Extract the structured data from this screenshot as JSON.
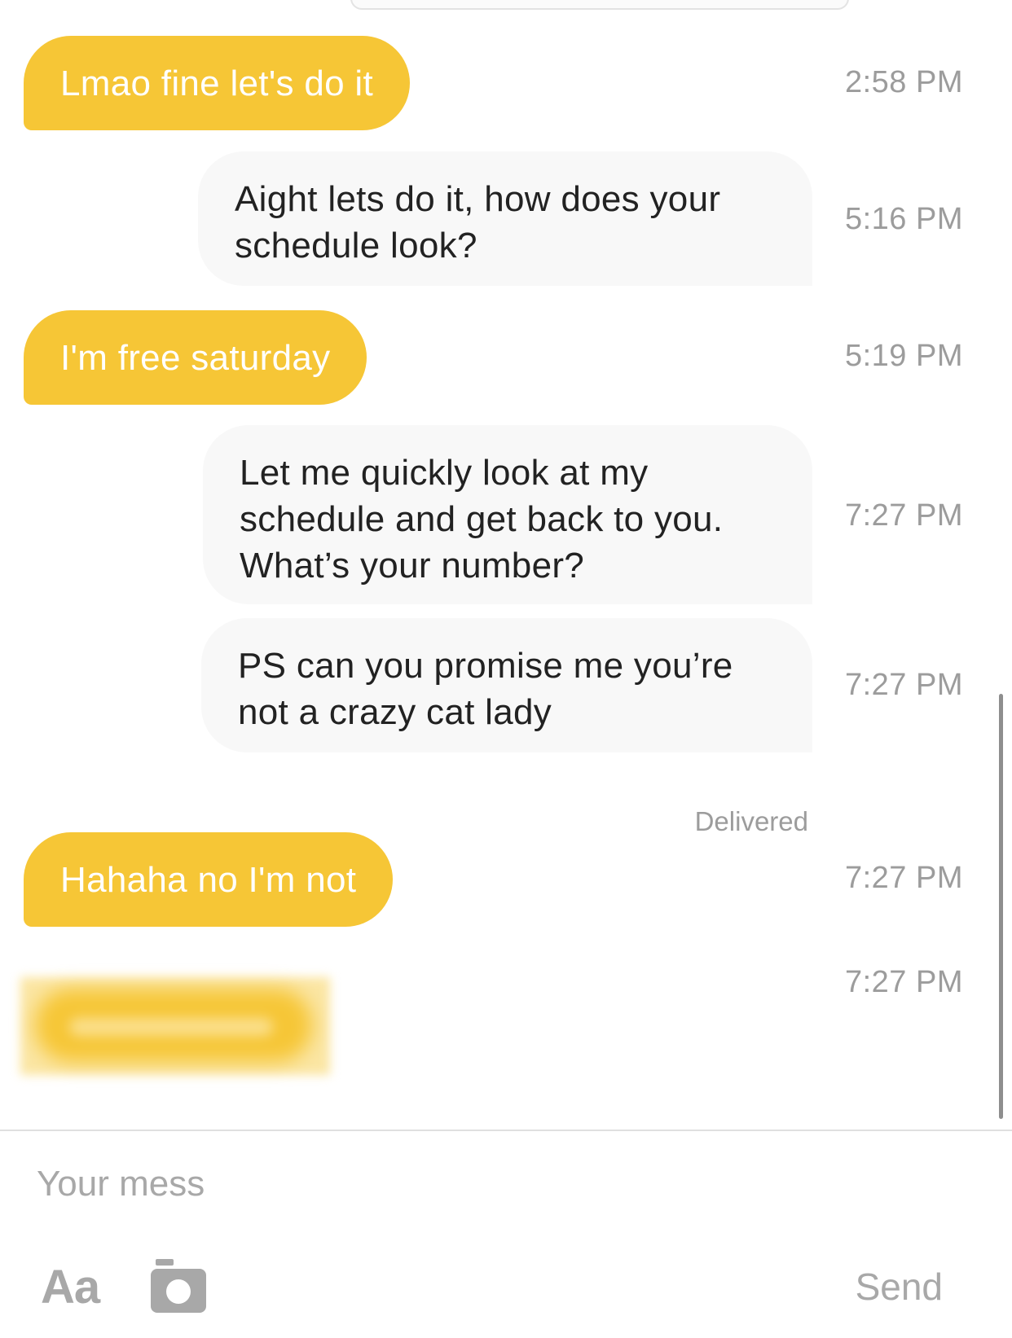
{
  "messages": [
    {
      "side": "in",
      "text": "Lmao fine let's do it",
      "time": "2:58 PM"
    },
    {
      "side": "out",
      "text": "Aight lets do it, how does your\nschedule look?",
      "time": "5:16 PM"
    },
    {
      "side": "in",
      "text": "I'm free saturday",
      "time": "5:19 PM"
    },
    {
      "side": "out",
      "text": "Let me quickly look at my\nschedule and get back to you.\nWhat’s your number?",
      "time": "7:27 PM"
    },
    {
      "side": "out",
      "text": "PS can you promise me you’re\nnot a crazy cat lady",
      "time": "7:27 PM"
    },
    {
      "side": "in",
      "text": "Hahaha no I'm not",
      "time": "7:27 PM"
    },
    {
      "side": "in",
      "text": "",
      "time": "7:27 PM"
    }
  ],
  "status": {
    "delivered": "Delivered"
  },
  "composer": {
    "placeholder": "Your mess",
    "font_label": "Aa",
    "send_label": "Send"
  },
  "icons": {
    "camera": "camera-icon"
  },
  "colors": {
    "incoming_bubble": "#f6c636",
    "outgoing_bubble": "#f8f8f8",
    "muted_text": "#9c9c9c"
  }
}
